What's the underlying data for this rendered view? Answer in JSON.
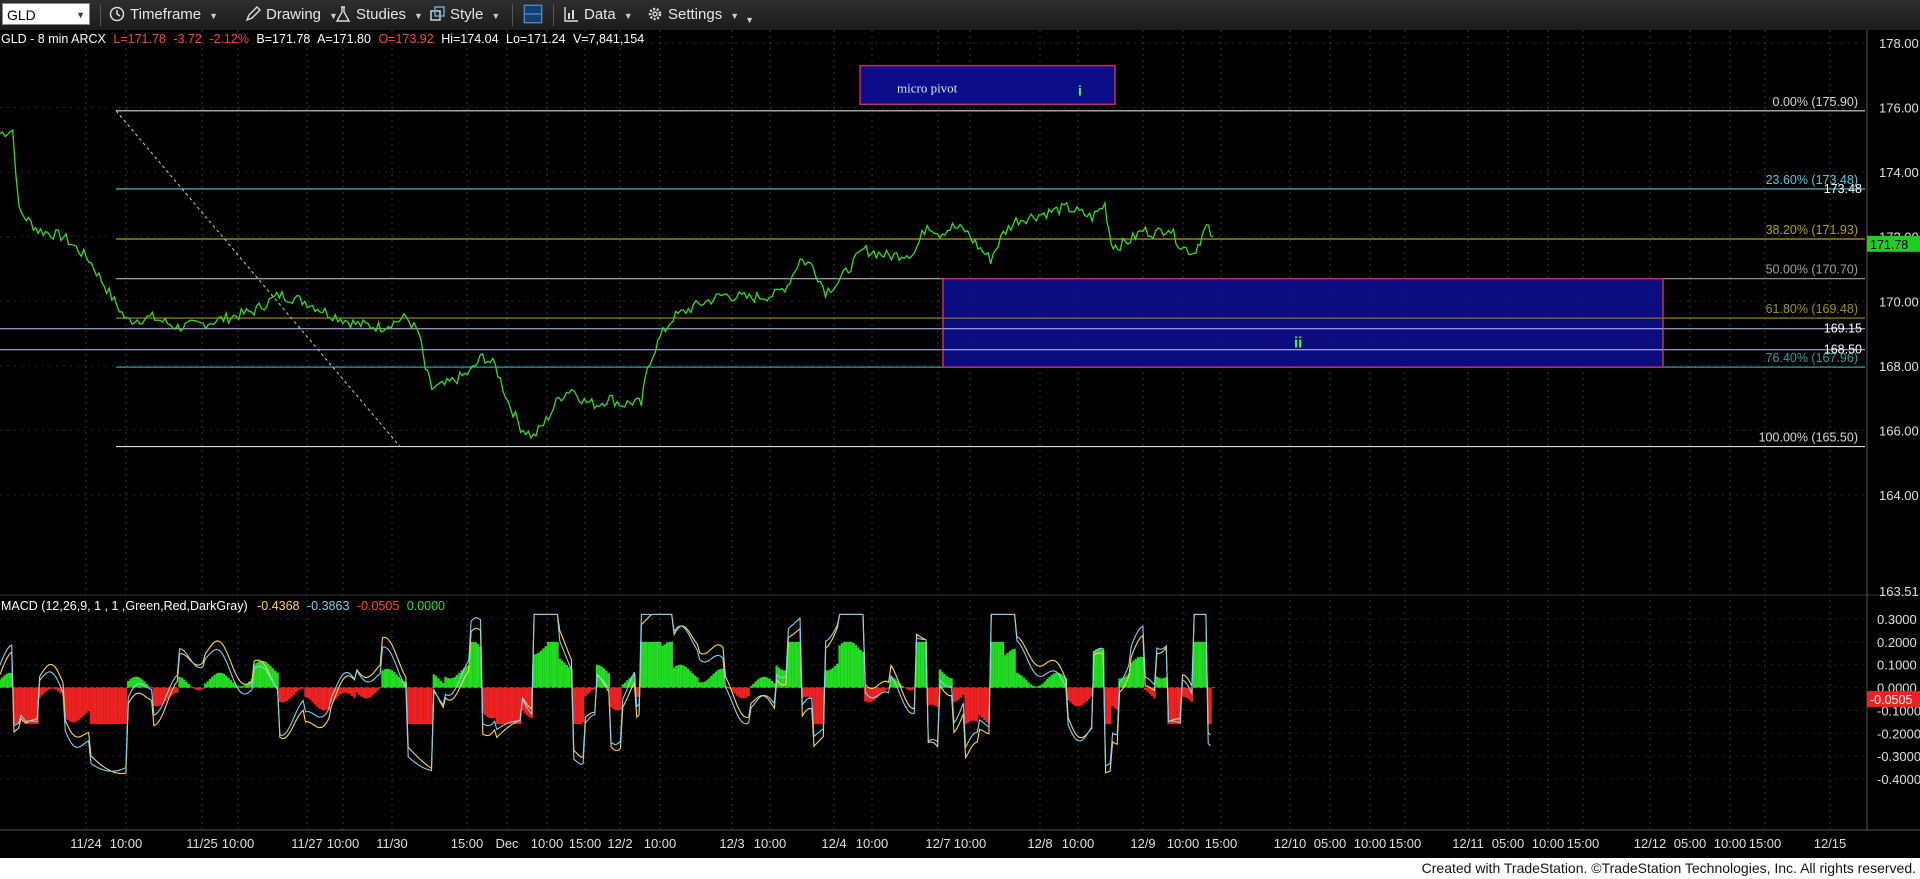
{
  "toolbar": {
    "symbol": "GLD",
    "timeframe_label": "Timeframe",
    "drawing_label": "Drawing",
    "studies_label": "Studies",
    "style_label": "Style",
    "data_label": "Data",
    "settings_label": "Settings",
    "icons": [
      "clock-icon",
      "pencil-icon",
      "flask-icon",
      "style-icon",
      "layout-icon",
      "bar-chart-icon",
      "gear-icon"
    ]
  },
  "price_header": {
    "symbol_line": "GLD - 8 min  ARCX",
    "last": "L=171.78",
    "net": "-3.72",
    "pct": "-2.12%",
    "bid": "B=171.78",
    "ask": "A=171.80",
    "open": "O=173.92",
    "high": "Hi=174.04",
    "low": "Lo=171.24",
    "volume": "V=7,841,154"
  },
  "macd_header": {
    "label": "MACD (12,26,9, 1 , 1 ,Green,Red,DarkGray)",
    "v1": "-0.4368",
    "v2": "-0.3863",
    "v3": "-0.0505",
    "v4": "0.0000"
  },
  "chart_data": {
    "type": "line",
    "interval": "8 min",
    "price_axis": {
      "ticks": [
        "178.00",
        "176.00",
        "174.00",
        "172.00",
        "170.00",
        "168.00",
        "166.00",
        "164.00",
        "163.51"
      ],
      "ylim": [
        163.5,
        178.5
      ],
      "last_price_tag": "171.78",
      "marker_tags": [
        "173.48",
        "169.15",
        "168.50"
      ]
    },
    "macd_axis": {
      "ticks": [
        "0.3000",
        "0.2000",
        "0.1000",
        "0.0000",
        "-0.1000",
        "-0.2000",
        "-0.3000",
        "-0.4000"
      ],
      "ylim": [
        -0.46,
        0.33
      ],
      "value_tag": "-0.0505"
    },
    "x_labels": [
      "11/24",
      "10:00",
      "11/25",
      "10:00",
      "11/27",
      "10:00",
      "11/30",
      "15:00",
      "Dec",
      "10:00",
      "15:00",
      "12/2",
      "10:00",
      "12/3",
      "10:00",
      "12/4",
      "10:00",
      "12/7",
      "10:00",
      "12/8",
      "10:00",
      "12/9",
      "10:00",
      "15:00",
      "12/10",
      "05:00",
      "10:00",
      "15:00",
      "12/11",
      "05:00",
      "10:00",
      "15:00",
      "12/12",
      "05:00",
      "10:00",
      "15:00",
      "12/15"
    ],
    "price_series": {
      "name": "GLD",
      "color": "#33dd22",
      "points": [
        [
          0,
          175.2
        ],
        [
          0.01,
          175.3
        ],
        [
          0.015,
          172.8
        ],
        [
          0.03,
          172.2
        ],
        [
          0.05,
          172.0
        ],
        [
          0.07,
          171.3
        ],
        [
          0.09,
          170.0
        ],
        [
          0.1,
          169.4
        ],
        [
          0.12,
          169.5
        ],
        [
          0.14,
          169.2
        ],
        [
          0.16,
          169.3
        ],
        [
          0.18,
          169.5
        ],
        [
          0.2,
          169.7
        ],
        [
          0.22,
          170.2
        ],
        [
          0.24,
          170.0
        ],
        [
          0.26,
          169.6
        ],
        [
          0.28,
          169.3
        ],
        [
          0.3,
          169.2
        ],
        [
          0.32,
          169.5
        ],
        [
          0.33,
          169.0
        ],
        [
          0.335,
          167.9
        ],
        [
          0.34,
          167.3
        ],
        [
          0.35,
          167.4
        ],
        [
          0.37,
          167.8
        ],
        [
          0.38,
          168.3
        ],
        [
          0.39,
          168.0
        ],
        [
          0.4,
          166.9
        ],
        [
          0.41,
          166.1
        ],
        [
          0.42,
          165.8
        ],
        [
          0.43,
          166.3
        ],
        [
          0.44,
          167.0
        ],
        [
          0.45,
          167.3
        ],
        [
          0.46,
          166.9
        ],
        [
          0.47,
          166.8
        ],
        [
          0.48,
          167.0
        ],
        [
          0.49,
          166.8
        ],
        [
          0.5,
          166.9
        ],
        [
          0.505,
          166.8
        ],
        [
          0.51,
          168.0
        ],
        [
          0.52,
          168.9
        ],
        [
          0.53,
          169.5
        ],
        [
          0.55,
          169.9
        ],
        [
          0.57,
          170.2
        ],
        [
          0.59,
          170.1
        ],
        [
          0.61,
          170.2
        ],
        [
          0.62,
          170.5
        ],
        [
          0.63,
          171.3
        ],
        [
          0.64,
          171.1
        ],
        [
          0.65,
          170.3
        ],
        [
          0.66,
          170.6
        ],
        [
          0.67,
          171.1
        ],
        [
          0.68,
          171.6
        ],
        [
          0.7,
          171.4
        ],
        [
          0.72,
          171.5
        ],
        [
          0.73,
          172.4
        ],
        [
          0.74,
          172.1
        ],
        [
          0.75,
          172.3
        ],
        [
          0.76,
          172.2
        ],
        [
          0.77,
          171.7
        ],
        [
          0.78,
          171.3
        ],
        [
          0.79,
          172.1
        ],
        [
          0.8,
          172.5
        ],
        [
          0.82,
          172.7
        ],
        [
          0.84,
          172.9
        ],
        [
          0.86,
          172.6
        ],
        [
          0.87,
          173.0
        ],
        [
          0.875,
          171.8
        ],
        [
          0.88,
          171.7
        ],
        [
          0.89,
          171.9
        ],
        [
          0.9,
          172.2
        ],
        [
          0.91,
          172.1
        ],
        [
          0.92,
          172.3
        ],
        [
          0.93,
          171.7
        ],
        [
          0.94,
          171.5
        ],
        [
          0.945,
          171.9
        ],
        [
          0.95,
          172.3
        ],
        [
          0.955,
          172.0
        ]
      ]
    },
    "fib_levels": [
      {
        "label": "0.00% (175.90)",
        "value": 175.9
      },
      {
        "label": "23.60% (173.48)",
        "value": 173.48
      },
      {
        "label": "38.20% (171.93)",
        "value": 171.93
      },
      {
        "label": "50.00% (170.70)",
        "value": 170.7
      },
      {
        "label": "61.80% (169.48)",
        "value": 169.48
      },
      {
        "label": "76.40% (167.96)",
        "value": 167.96
      },
      {
        "label": "100.00% (165.50)",
        "value": 165.5
      }
    ],
    "horizontal_lines": [
      169.15,
      168.5
    ],
    "annotations": [
      {
        "text": "micro pivot",
        "kind": "box"
      },
      {
        "text": "i",
        "kind": "wave-label"
      },
      {
        "text": "ii",
        "kind": "wave-label"
      }
    ],
    "target_box": {
      "from": 170.7,
      "to": 167.96
    }
  },
  "footer": {
    "text": "Created with TradeStation. ©TradeStation Technologies, Inc. All rights reserved."
  }
}
